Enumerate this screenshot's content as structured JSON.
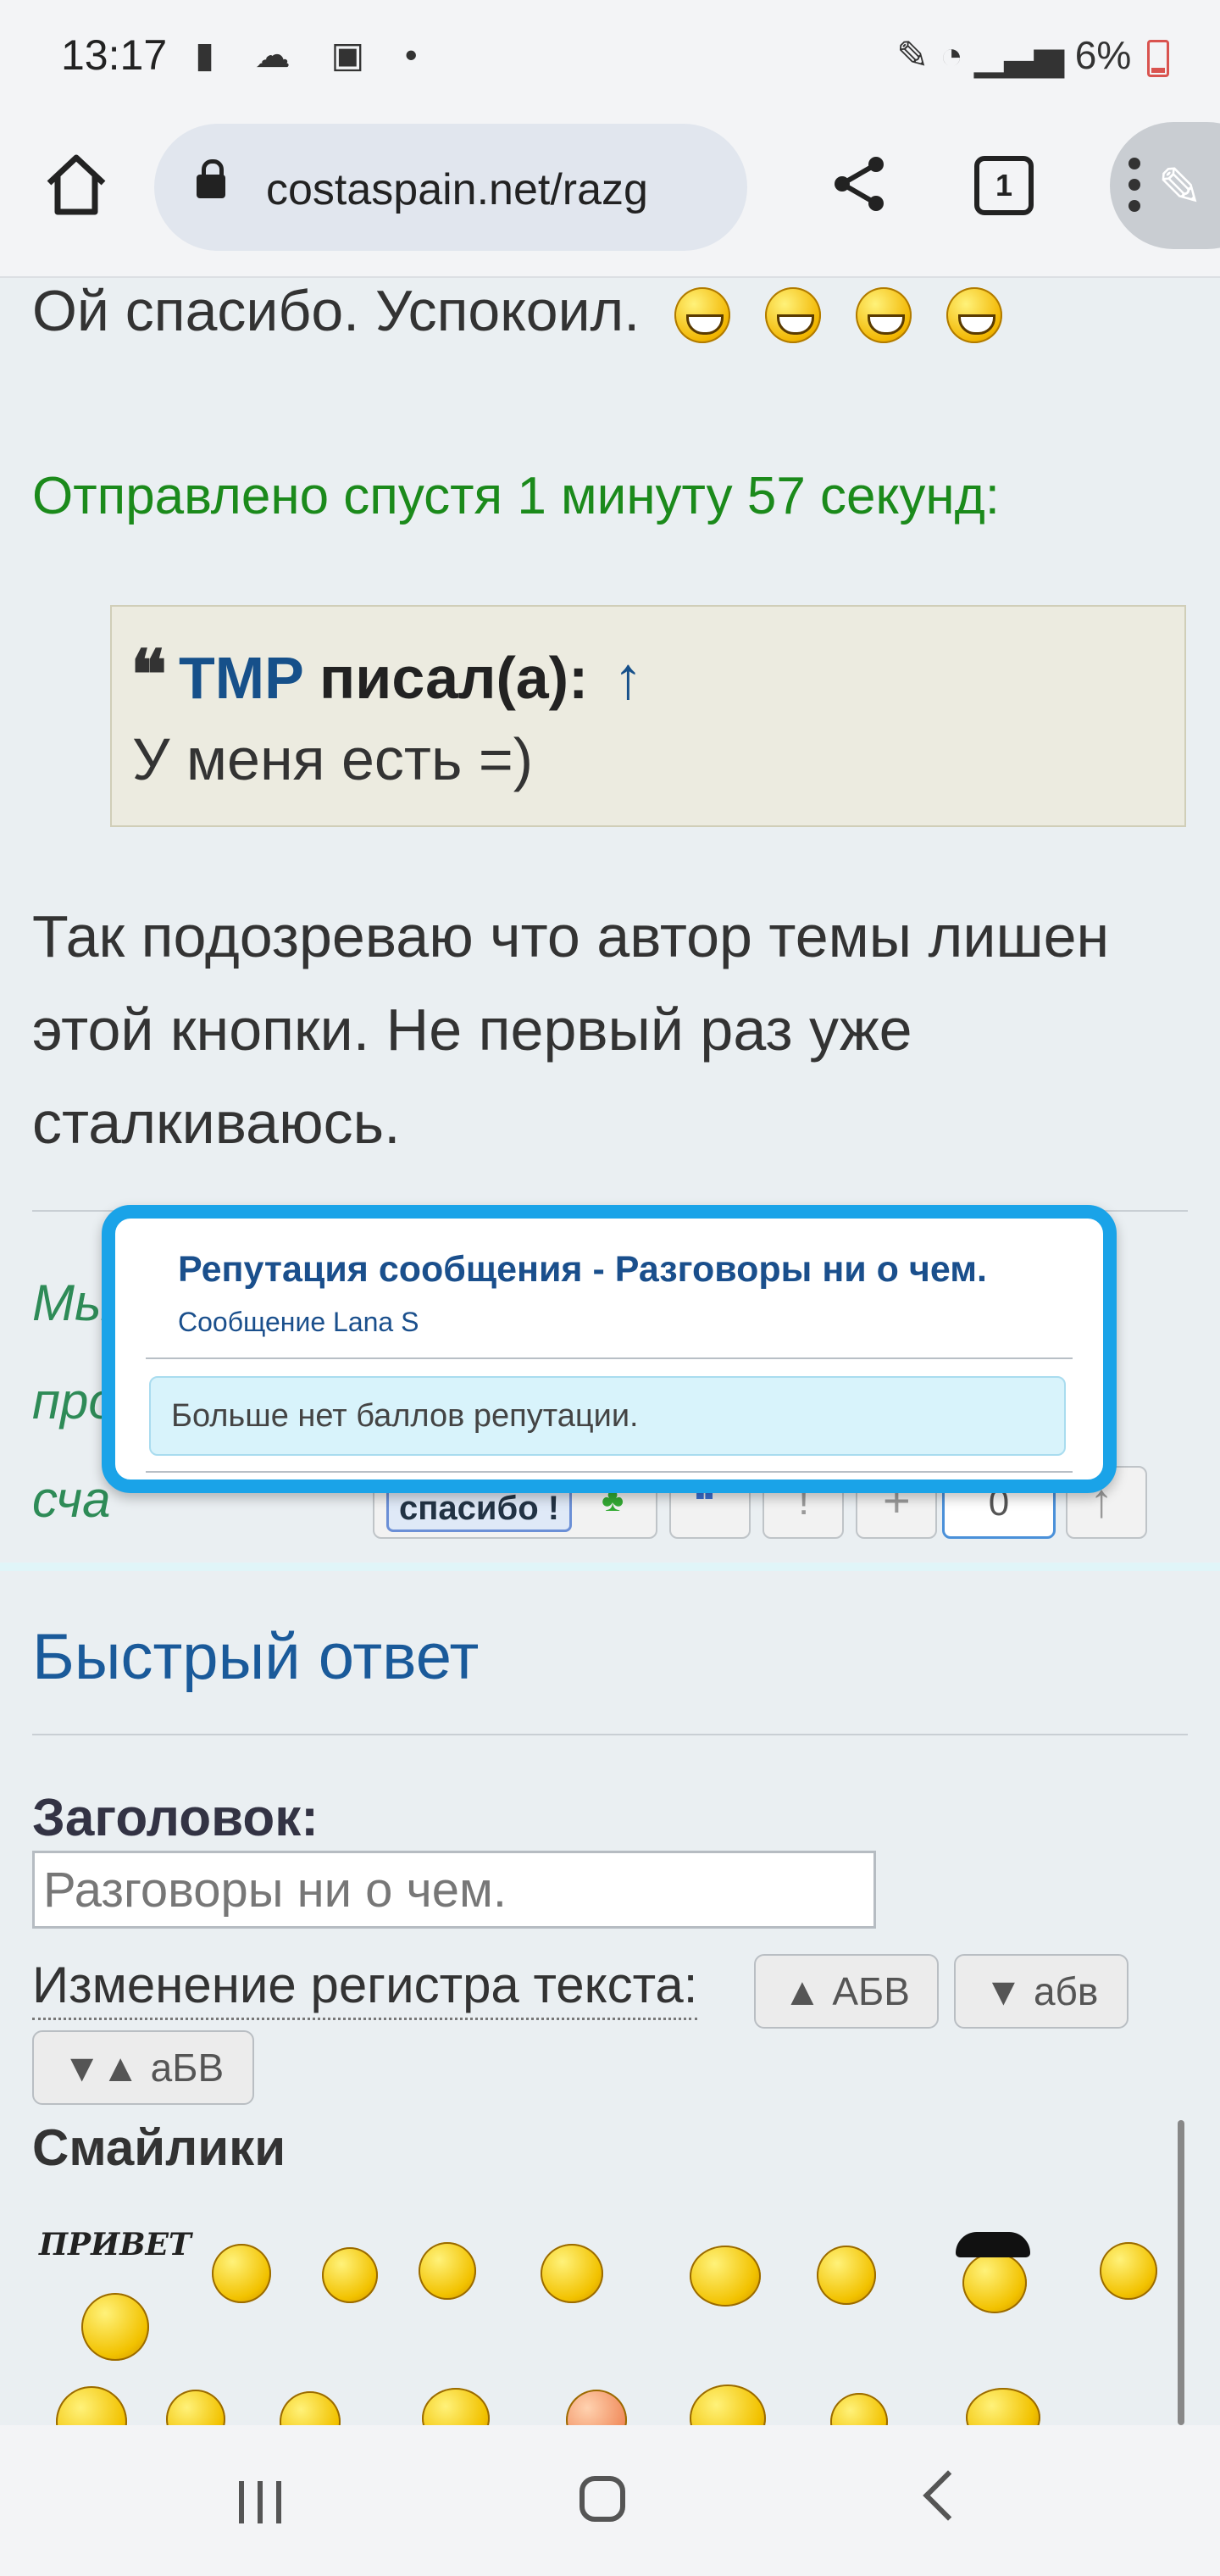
{
  "status_bar": {
    "time": "13:17",
    "left_icons": [
      "alert-icon",
      "cloud-icon",
      "image-icon",
      "dot-icon"
    ],
    "battery": "6%"
  },
  "browser": {
    "url": "costaspain.net/razg",
    "tab_count": "1"
  },
  "post": {
    "line1": "Ой спасибо. Успокоил.",
    "sent_note": "Отправлено спустя 1 минуту 57 секунд:",
    "quote": {
      "author": "TMP",
      "wrote": "писал(а):",
      "arrow": "↑",
      "text": "У меня есть =)"
    },
    "body": "Так подозреваю что автор темы лишен этой кнопки. Не первый раз уже сталкиваюсь.",
    "signature_partial": [
      "Мы",
      "про",
      "сча"
    ]
  },
  "post_buttons": {
    "thanks_label": "спасибо !",
    "reputation_count": "0"
  },
  "reputation_popup": {
    "title": "Репутация сообщения - Разговоры ни о чем.",
    "subtitle": "Сообщение Lana S",
    "message": "Больше нет баллов репутации."
  },
  "quick_reply": {
    "heading": "Быстрый ответ",
    "title_label": "Заголовок:",
    "title_value": "Разговоры ни о чем.",
    "case_label": "Изменение регистра текста:",
    "case_buttons": [
      "▲ АБВ",
      "▼ абв",
      "▼▲ аБВ"
    ],
    "smilies_label": "Смайлики",
    "privet": "ПРИВЕТ"
  },
  "colors": {
    "link_blue": "#1a5a9a",
    "green_note": "#1b8a1b",
    "popup_border": "#1aa3e8",
    "battery_low": "#d9534f"
  }
}
